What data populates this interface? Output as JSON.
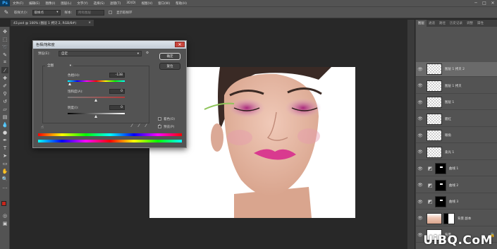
{
  "menubar": {
    "logo": "Ps",
    "items": [
      "文件(F)",
      "编辑(E)",
      "图像(I)",
      "图层(L)",
      "文字(Y)",
      "选择(S)",
      "滤镜(T)",
      "3D(D)",
      "视图(V)",
      "窗口(W)",
      "帮助(H)"
    ],
    "minimize": "─",
    "maximize": "□",
    "close": "✕"
  },
  "options": {
    "tool_icon": "✎",
    "size_label": "取样大小:",
    "size_value": "取样点",
    "sample_label": "样本:",
    "sample_value": "所有图层",
    "ring_label": "显示取样环"
  },
  "document": {
    "tab_title": "43.psd @ 100% (图层 1 拷贝 2, RGB/8#)",
    "tab_close": "×"
  },
  "dialog": {
    "title": "色相/饱和度",
    "close": "✕",
    "preset_label": "预设(E):",
    "preset_value": "自定",
    "ok": "确定",
    "cancel": "复位",
    "channel_value": "全图",
    "hue_label": "色相(H):",
    "hue_value": "-138",
    "sat_label": "饱和度(A):",
    "sat_value": "0",
    "light_label": "明度(I):",
    "light_value": "0",
    "colorize_label": "着色(O)",
    "preview_label": "预览(P)",
    "colorize_checked": false,
    "preview_checked": true,
    "hue_fraction": 0.04,
    "sat_fraction": 0.5,
    "light_fraction": 0.5
  },
  "layers": {
    "tabs": [
      "图层",
      "通道",
      "路径",
      "历史记录",
      "调整",
      "属性"
    ],
    "rows": [
      {
        "name": "图层 1 拷贝 2",
        "kind": "pixel",
        "selected": true
      },
      {
        "name": "图层 1 拷贝",
        "kind": "pixel",
        "selected": false
      },
      {
        "name": "图层 1",
        "kind": "pixel",
        "selected": false
      },
      {
        "name": "腮红",
        "kind": "pixel",
        "selected": false
      },
      {
        "name": "眼角",
        "kind": "pixel",
        "selected": false
      },
      {
        "name": "柔光 1",
        "kind": "pixel",
        "selected": false
      },
      {
        "name": "曲线 1",
        "kind": "adjust",
        "selected": false
      },
      {
        "name": "曲线 2",
        "kind": "adjust",
        "selected": false
      },
      {
        "name": "曲线 3",
        "kind": "adjust",
        "selected": false
      },
      {
        "name": "背景 副本",
        "kind": "photo",
        "selected": false
      },
      {
        "name": "背景",
        "kind": "white",
        "selected": false
      }
    ]
  },
  "watermark": "UiBQ.CoM",
  "colors": {
    "foreground": "#c8261c",
    "background": "#ffffff",
    "eye_shadow": "#c0348e",
    "lips": "#d93a8f"
  }
}
